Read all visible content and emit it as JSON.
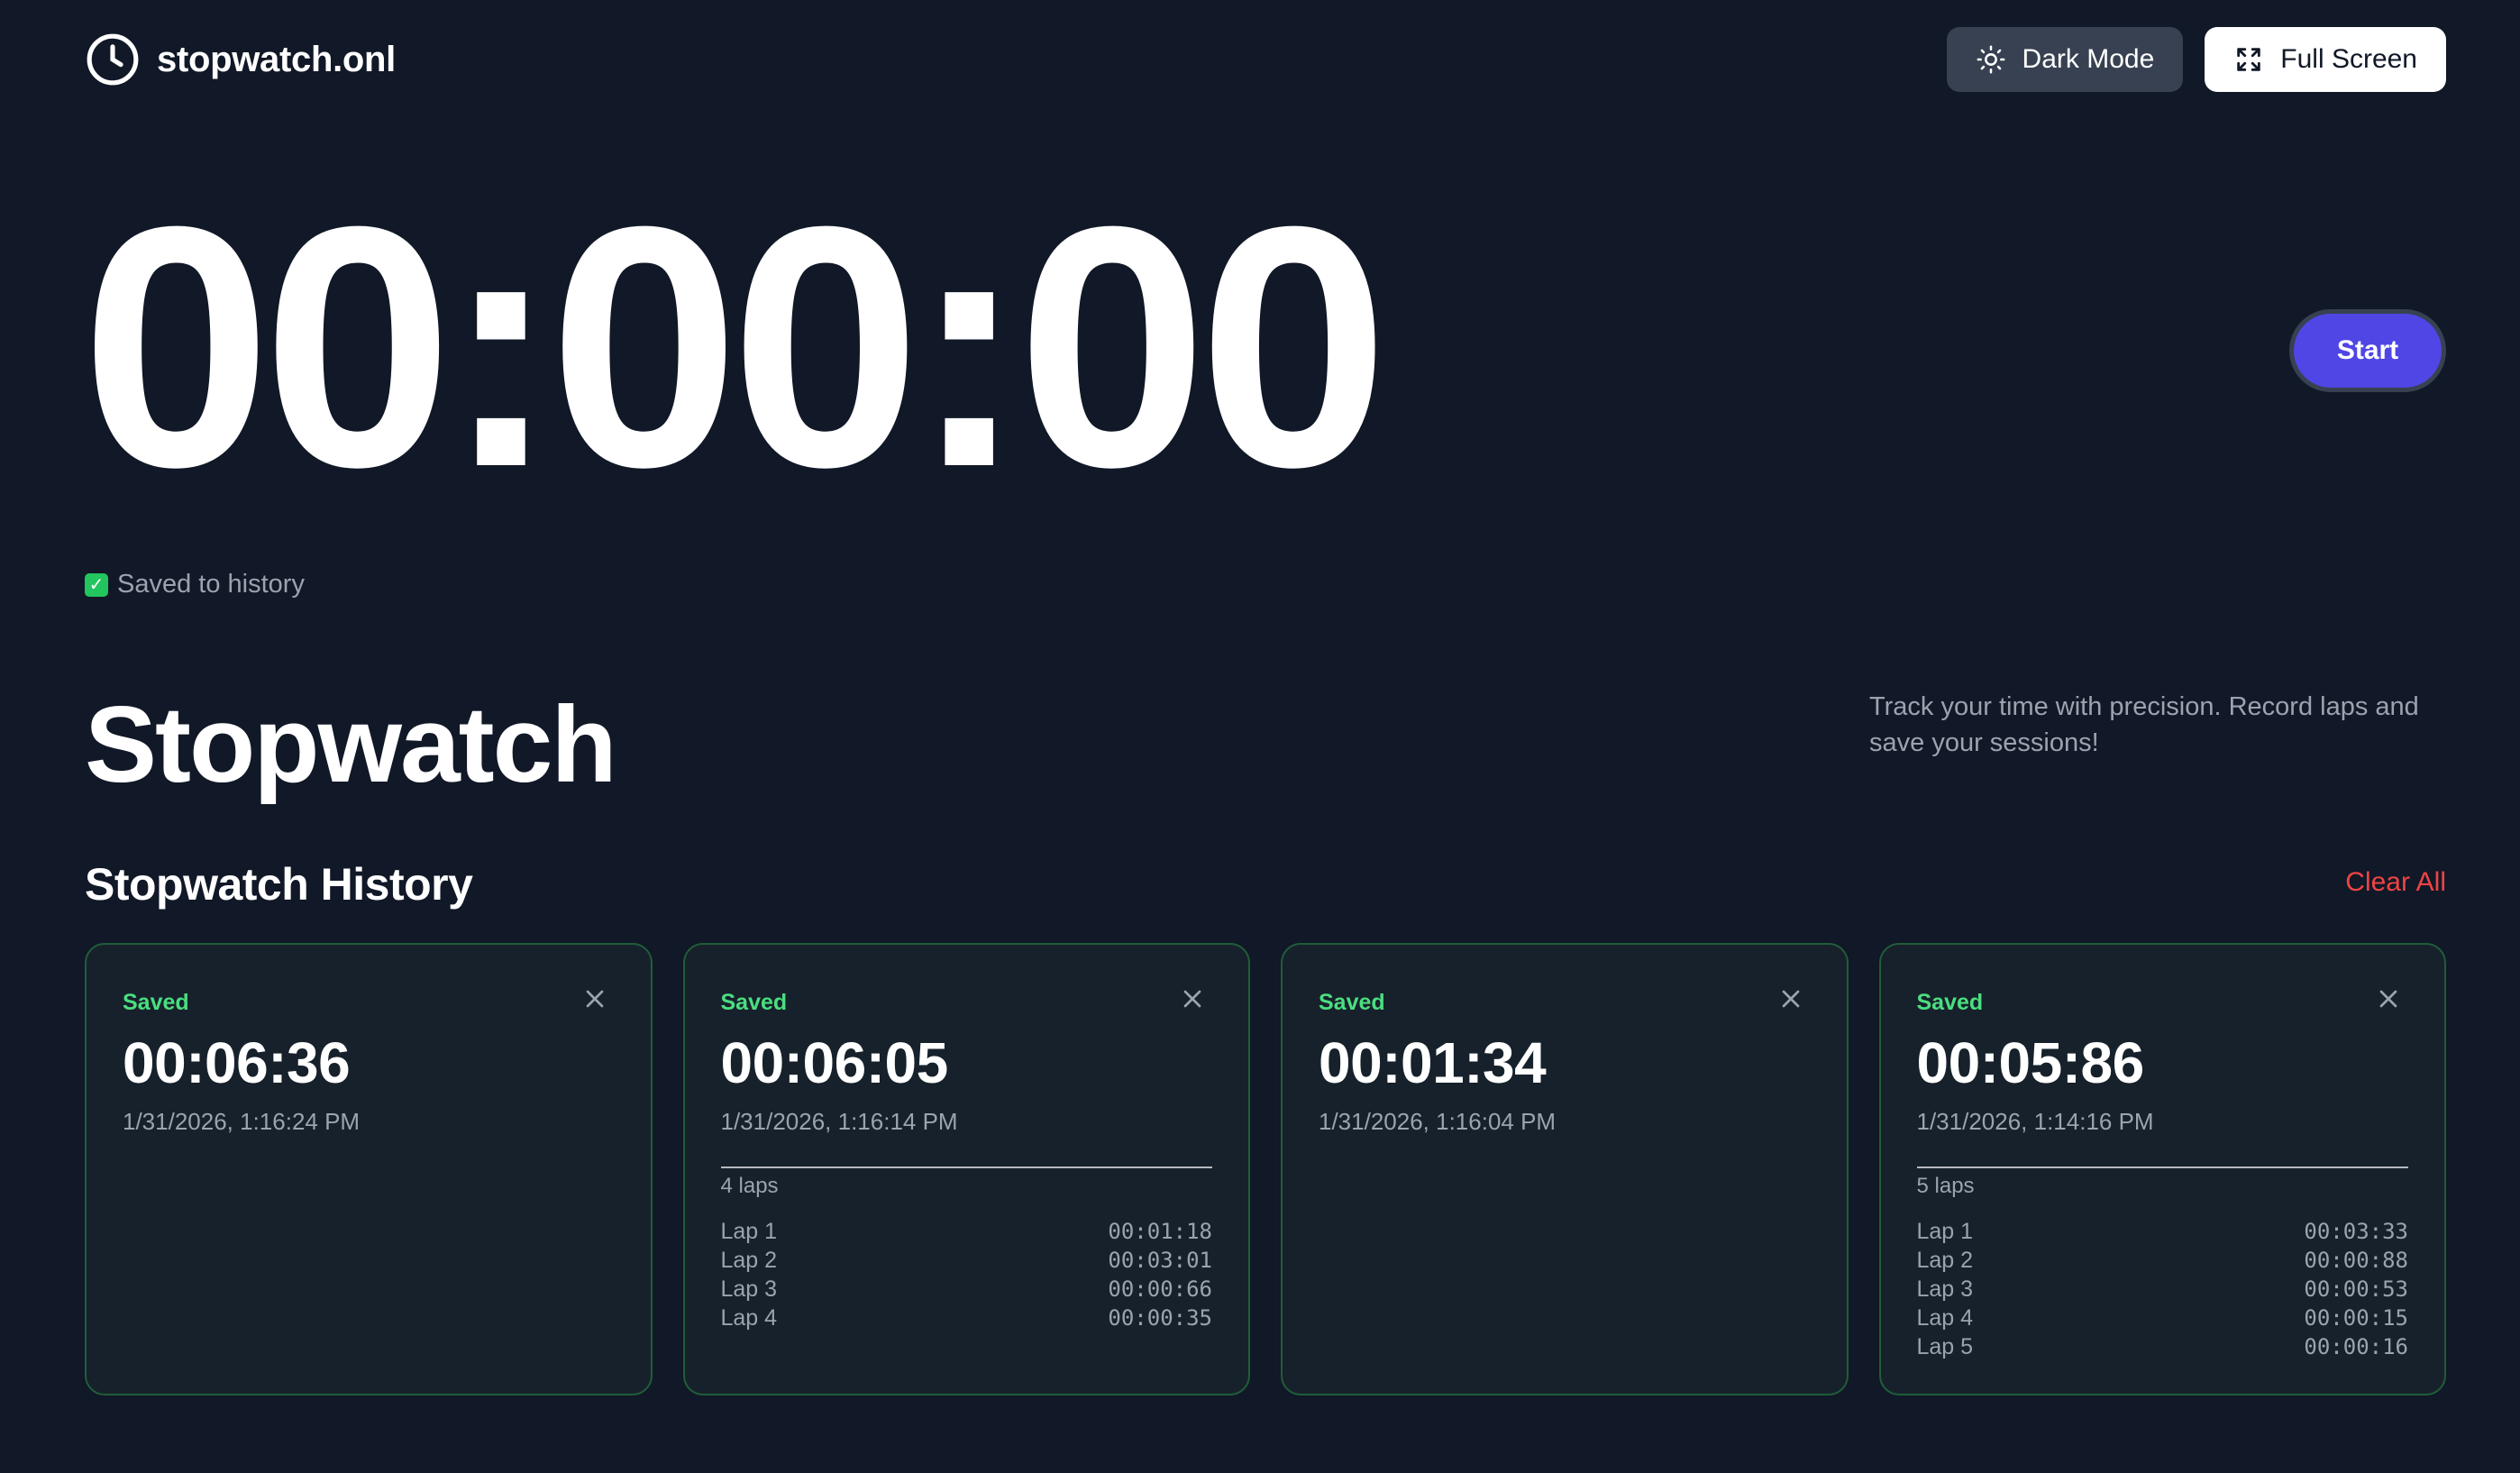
{
  "header": {
    "brand": "stopwatch.onl",
    "dark_mode_label": "Dark Mode",
    "full_screen_label": "Full Screen"
  },
  "timer": {
    "display": "00:00:00",
    "start_label": "Start"
  },
  "saved_note": "Saved to history",
  "page_title": "Stopwatch",
  "description": "Track your time with precision. Record laps and save your sessions!",
  "history": {
    "title": "Stopwatch History",
    "clear_all_label": "Clear All",
    "cards": [
      {
        "status": "Saved",
        "time": "00:06:36",
        "date": "1/31/2026, 1:16:24 PM",
        "laps_label": "",
        "laps": []
      },
      {
        "status": "Saved",
        "time": "00:06:05",
        "date": "1/31/2026, 1:16:14 PM",
        "laps_label": "4 laps",
        "laps": [
          {
            "name": "Lap 1",
            "time": "00:01:18"
          },
          {
            "name": "Lap 2",
            "time": "00:03:01"
          },
          {
            "name": "Lap 3",
            "time": "00:00:66"
          },
          {
            "name": "Lap 4",
            "time": "00:00:35"
          }
        ]
      },
      {
        "status": "Saved",
        "time": "00:01:34",
        "date": "1/31/2026, 1:16:04 PM",
        "laps_label": "",
        "laps": []
      },
      {
        "status": "Saved",
        "time": "00:05:86",
        "date": "1/31/2026, 1:14:16 PM",
        "laps_label": "5 laps",
        "laps": [
          {
            "name": "Lap 1",
            "time": "00:03:33"
          },
          {
            "name": "Lap 2",
            "time": "00:00:88"
          },
          {
            "name": "Lap 3",
            "time": "00:00:53"
          },
          {
            "name": "Lap 4",
            "time": "00:00:15"
          },
          {
            "name": "Lap 5",
            "time": "00:00:16"
          }
        ]
      }
    ]
  },
  "icons": {
    "brand": "clock-icon",
    "dark_mode": "sun-icon",
    "full_screen": "expand-icon",
    "saved": "check-icon",
    "card_close": "close-icon"
  },
  "colors": {
    "background": "#111827",
    "accent": "#4f46e5",
    "saved_green": "#4ade80",
    "danger": "#ef4444",
    "card_border": "#1f5e38"
  }
}
